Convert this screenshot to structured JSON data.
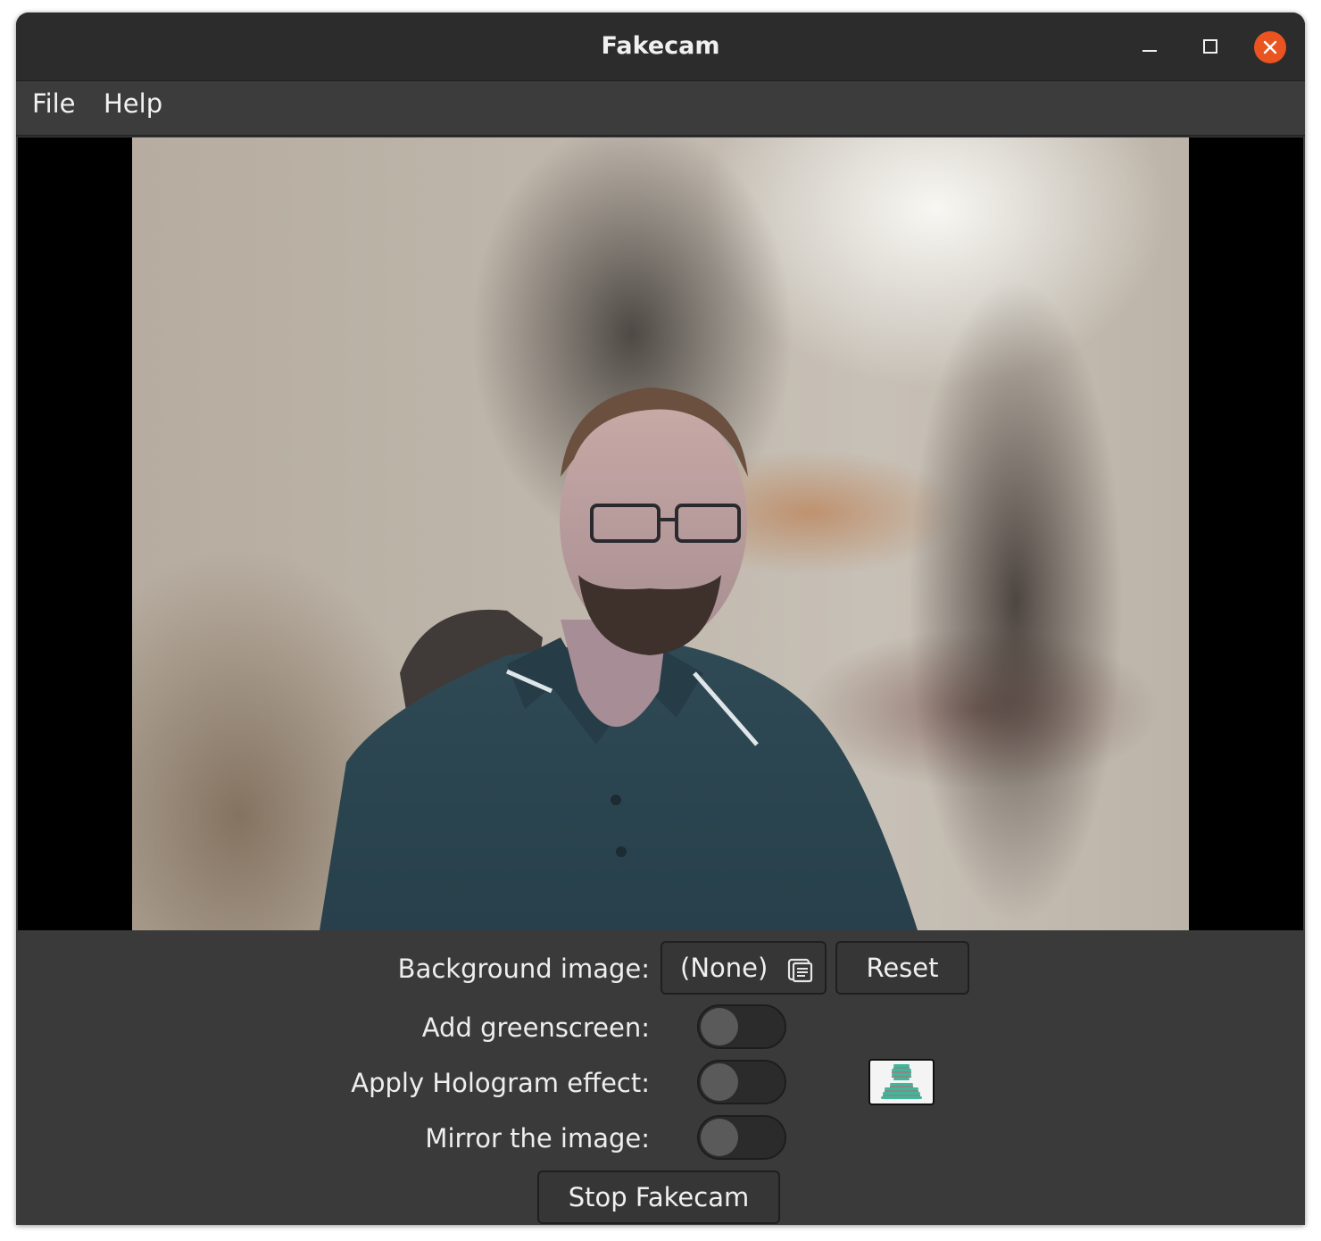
{
  "window": {
    "title": "Fakecam"
  },
  "menubar": {
    "items": [
      {
        "label": "File"
      },
      {
        "label": "Help"
      }
    ]
  },
  "preview": {
    "content": "webcam-feed-blurred-background"
  },
  "controls": {
    "background_image": {
      "label": "Background image:",
      "value": "(None)",
      "icon": "file-open-icon",
      "reset_label": "Reset"
    },
    "greenscreen": {
      "label": "Add greenscreen:",
      "enabled": false
    },
    "hologram": {
      "label": "Apply Hologram effect:",
      "enabled": false,
      "preview_icon": "hologram-preview-icon"
    },
    "mirror": {
      "label": "Mirror the image:",
      "enabled": false
    },
    "stop_label": "Stop Fakecam"
  },
  "colors": {
    "window_bg": "#3a3a3a",
    "titlebar_bg": "#2c2c2c",
    "close_button": "#e95420",
    "hologram_accent": "#3cb89a"
  }
}
